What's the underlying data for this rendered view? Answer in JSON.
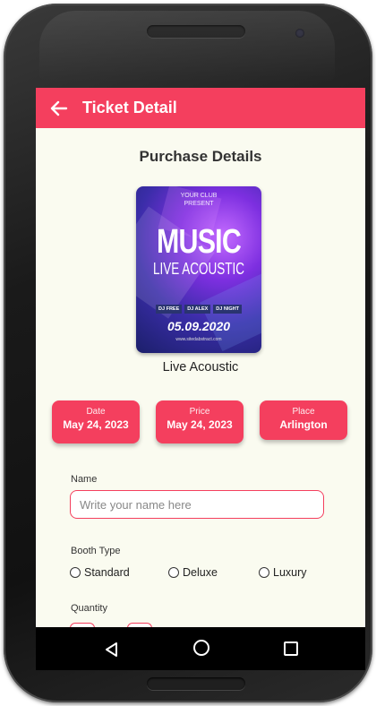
{
  "appbar": {
    "title": "Ticket Detail"
  },
  "page": {
    "heading": "Purchase Details"
  },
  "poster": {
    "club_line1": "YOUR CLUB",
    "club_line2": "PRESENT",
    "headline": "MUSIC",
    "subhead": "LIVE ACOUSTIC",
    "djs": [
      "DJ FREE",
      "DJ ALEX",
      "DJ NIGHT"
    ],
    "date": "05.09.2020",
    "url": "www.sitedabstract.com"
  },
  "event": {
    "name": "Live Acoustic"
  },
  "chips": [
    {
      "label": "Date",
      "value": "May 24, 2023"
    },
    {
      "label": "Price",
      "value": "May 24, 2023"
    },
    {
      "label": "Place",
      "value": "Arlington"
    }
  ],
  "form": {
    "name_label": "Name",
    "name_placeholder": "Write your name here",
    "name_value": "",
    "booth_label": "Booth Type",
    "booth_options": [
      "Standard",
      "Deluxe",
      "Luxury"
    ],
    "quantity_label": "Quantity"
  },
  "colors": {
    "accent": "#f43f5e",
    "background": "#fafbf0"
  }
}
